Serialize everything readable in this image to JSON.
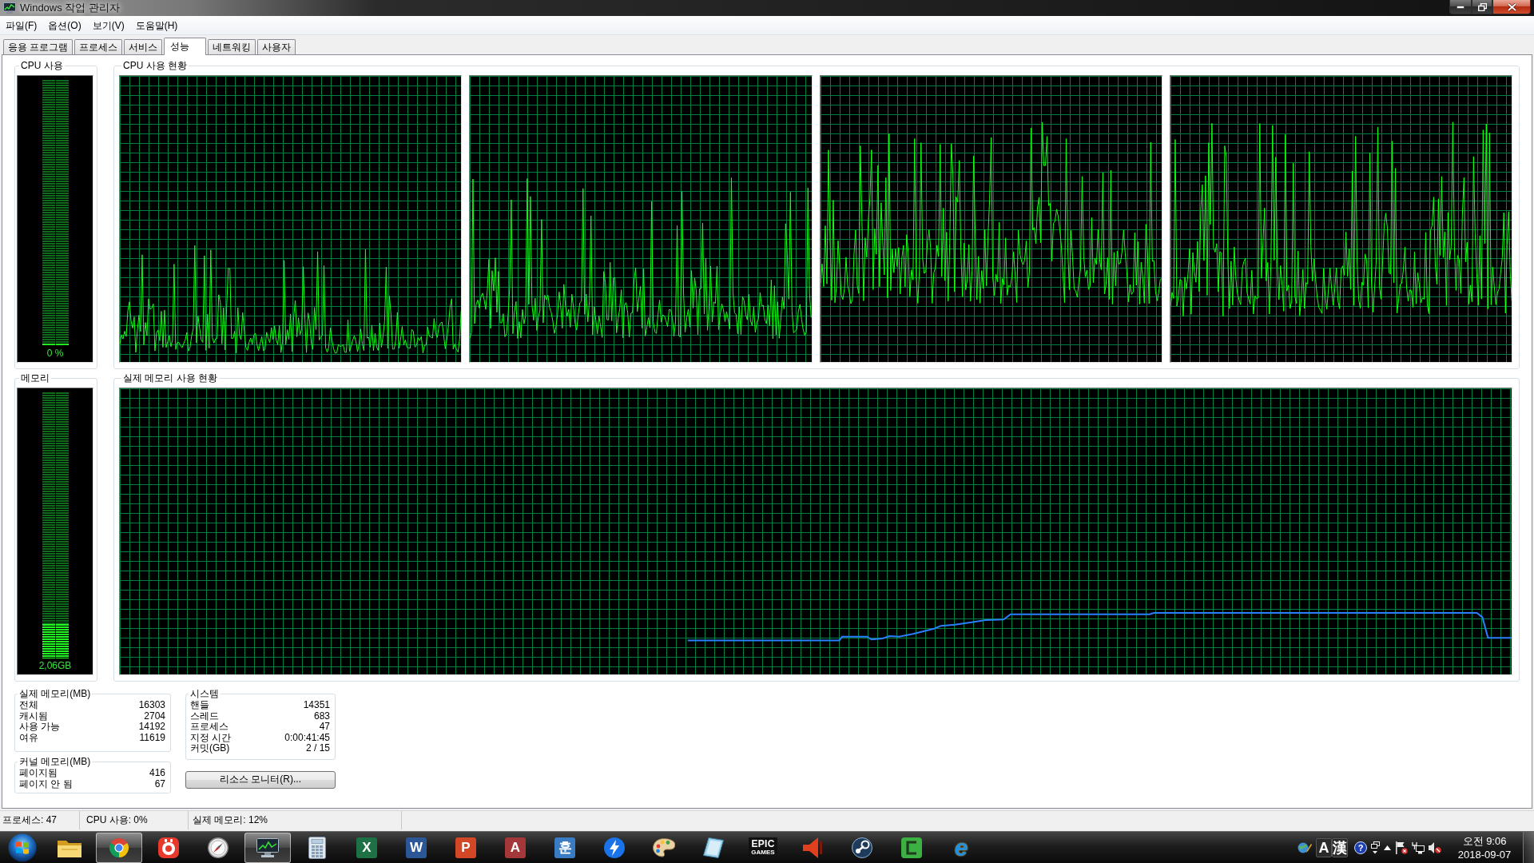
{
  "window": {
    "title": "Windows 작업 관리자"
  },
  "menu": [
    "파일(F)",
    "옵션(O)",
    "보기(V)",
    "도움말(H)"
  ],
  "tabs": [
    {
      "label": "응용 프로그램",
      "selected": false
    },
    {
      "label": "프로세스",
      "selected": false
    },
    {
      "label": "서비스",
      "selected": false
    },
    {
      "label": "성능",
      "selected": true
    },
    {
      "label": "네트워킹",
      "selected": false
    },
    {
      "label": "사용자",
      "selected": false
    }
  ],
  "cpu_usage": {
    "title": "CPU 사용",
    "level": 0,
    "reading": "0 %"
  },
  "cpu_history": {
    "title": "CPU 사용 현황"
  },
  "memory": {
    "title": "메모리",
    "level": 0.13,
    "reading": "2,06GB"
  },
  "memory_history": {
    "title": "실제 메모리 사용 현황"
  },
  "physical_memory": {
    "title": "실제 메모리(MB)",
    "rows": [
      {
        "label": "전체",
        "value": "16303"
      },
      {
        "label": "캐시됨",
        "value": "2704"
      },
      {
        "label": "사용 가능",
        "value": "14192"
      },
      {
        "label": "여유",
        "value": "11619"
      }
    ]
  },
  "kernel_memory": {
    "title": "커널 메모리(MB)",
    "rows": [
      {
        "label": "페이지됨",
        "value": "416"
      },
      {
        "label": "페이지 안 됨",
        "value": "67"
      }
    ]
  },
  "system": {
    "title": "시스템",
    "rows": [
      {
        "label": "핸들",
        "value": "14351"
      },
      {
        "label": "스레드",
        "value": "683"
      },
      {
        "label": "프로세스",
        "value": "47"
      },
      {
        "label": "지정 시간",
        "value": "0:00:41:45"
      },
      {
        "label": "커밋(GB)",
        "value": "2 / 15"
      }
    ]
  },
  "resource_monitor_button": {
    "label": "리소스 모니터(R)..."
  },
  "status_bar": [
    "프로세스: 47",
    "CPU 사용: 0%",
    "실제 메모리: 12%"
  ],
  "taskbar": {
    "apps": [
      {
        "kind": "folder",
        "running": false
      },
      {
        "kind": "segmented_circle",
        "running": true
      },
      {
        "kind": "ring_tile",
        "color": "#e8392c",
        "running": false
      },
      {
        "kind": "dial",
        "running": false
      },
      {
        "kind": "monitor",
        "running": true
      },
      {
        "kind": "calculator",
        "running": false
      },
      {
        "kind": "letter_tile",
        "glyph": "X",
        "color": "#1e7145",
        "running": false
      },
      {
        "kind": "letter_tile",
        "glyph": "W",
        "color": "#2b5797",
        "running": false
      },
      {
        "kind": "letter_tile",
        "glyph": "P",
        "color": "#d24726",
        "running": false
      },
      {
        "kind": "letter_tile",
        "glyph": "A",
        "color": "#a4373a",
        "running": false
      },
      {
        "kind": "letter_tile",
        "glyph": "훈",
        "color": "#3a7cc4",
        "running": false
      },
      {
        "kind": "bolt_circle",
        "color": "#1a73e8",
        "running": false
      },
      {
        "kind": "palette",
        "running": false
      },
      {
        "kind": "tilted_pad",
        "running": false
      },
      {
        "kind": "text_logo",
        "glyph": "EPIC",
        "sub": "GAMES",
        "running": false
      },
      {
        "kind": "speaker_cone",
        "color": "#e0401e",
        "running": false
      },
      {
        "kind": "disc_logo",
        "running": false
      },
      {
        "kind": "bracket_tile",
        "color": "#3cb043",
        "running": false
      },
      {
        "kind": "letter_logo",
        "glyph": "e",
        "color": "#1e8fe6",
        "running": false
      }
    ],
    "tray": [
      {
        "kind": "globe_pencil"
      },
      {
        "kind": "ime",
        "glyph": "A"
      },
      {
        "kind": "ime",
        "glyph": "漢"
      },
      {
        "kind": "help",
        "glyph": "?"
      },
      {
        "kind": "squares"
      },
      {
        "kind": "caret"
      },
      {
        "kind": "flag"
      },
      {
        "kind": "network"
      },
      {
        "kind": "speaker_muted"
      }
    ],
    "clock": {
      "time": "오전 9:06",
      "date": "2018-09-07"
    }
  }
}
